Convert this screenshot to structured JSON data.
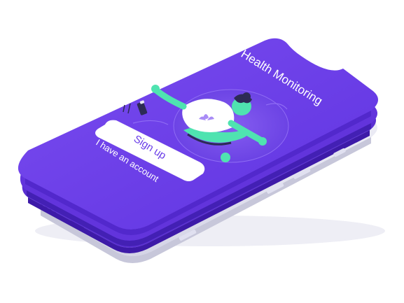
{
  "app": {
    "title": "Health Monitoring"
  },
  "actions": {
    "primary_label": "Sign up",
    "secondary_label": "I have an account"
  },
  "illustration": {
    "icon": "meditation-person-icon",
    "badge_icon": "lotus-icon"
  },
  "colors": {
    "screen": "#6a3de8",
    "body_dark": "#4a22c4",
    "body_mid": "#5b2fd6",
    "frame_light": "#e6e6f2",
    "frame_shadow": "#c9c9dc",
    "accent_green": "#4fe3b0",
    "button_bg": "#ffffff",
    "button_text": "#6a3de8"
  }
}
